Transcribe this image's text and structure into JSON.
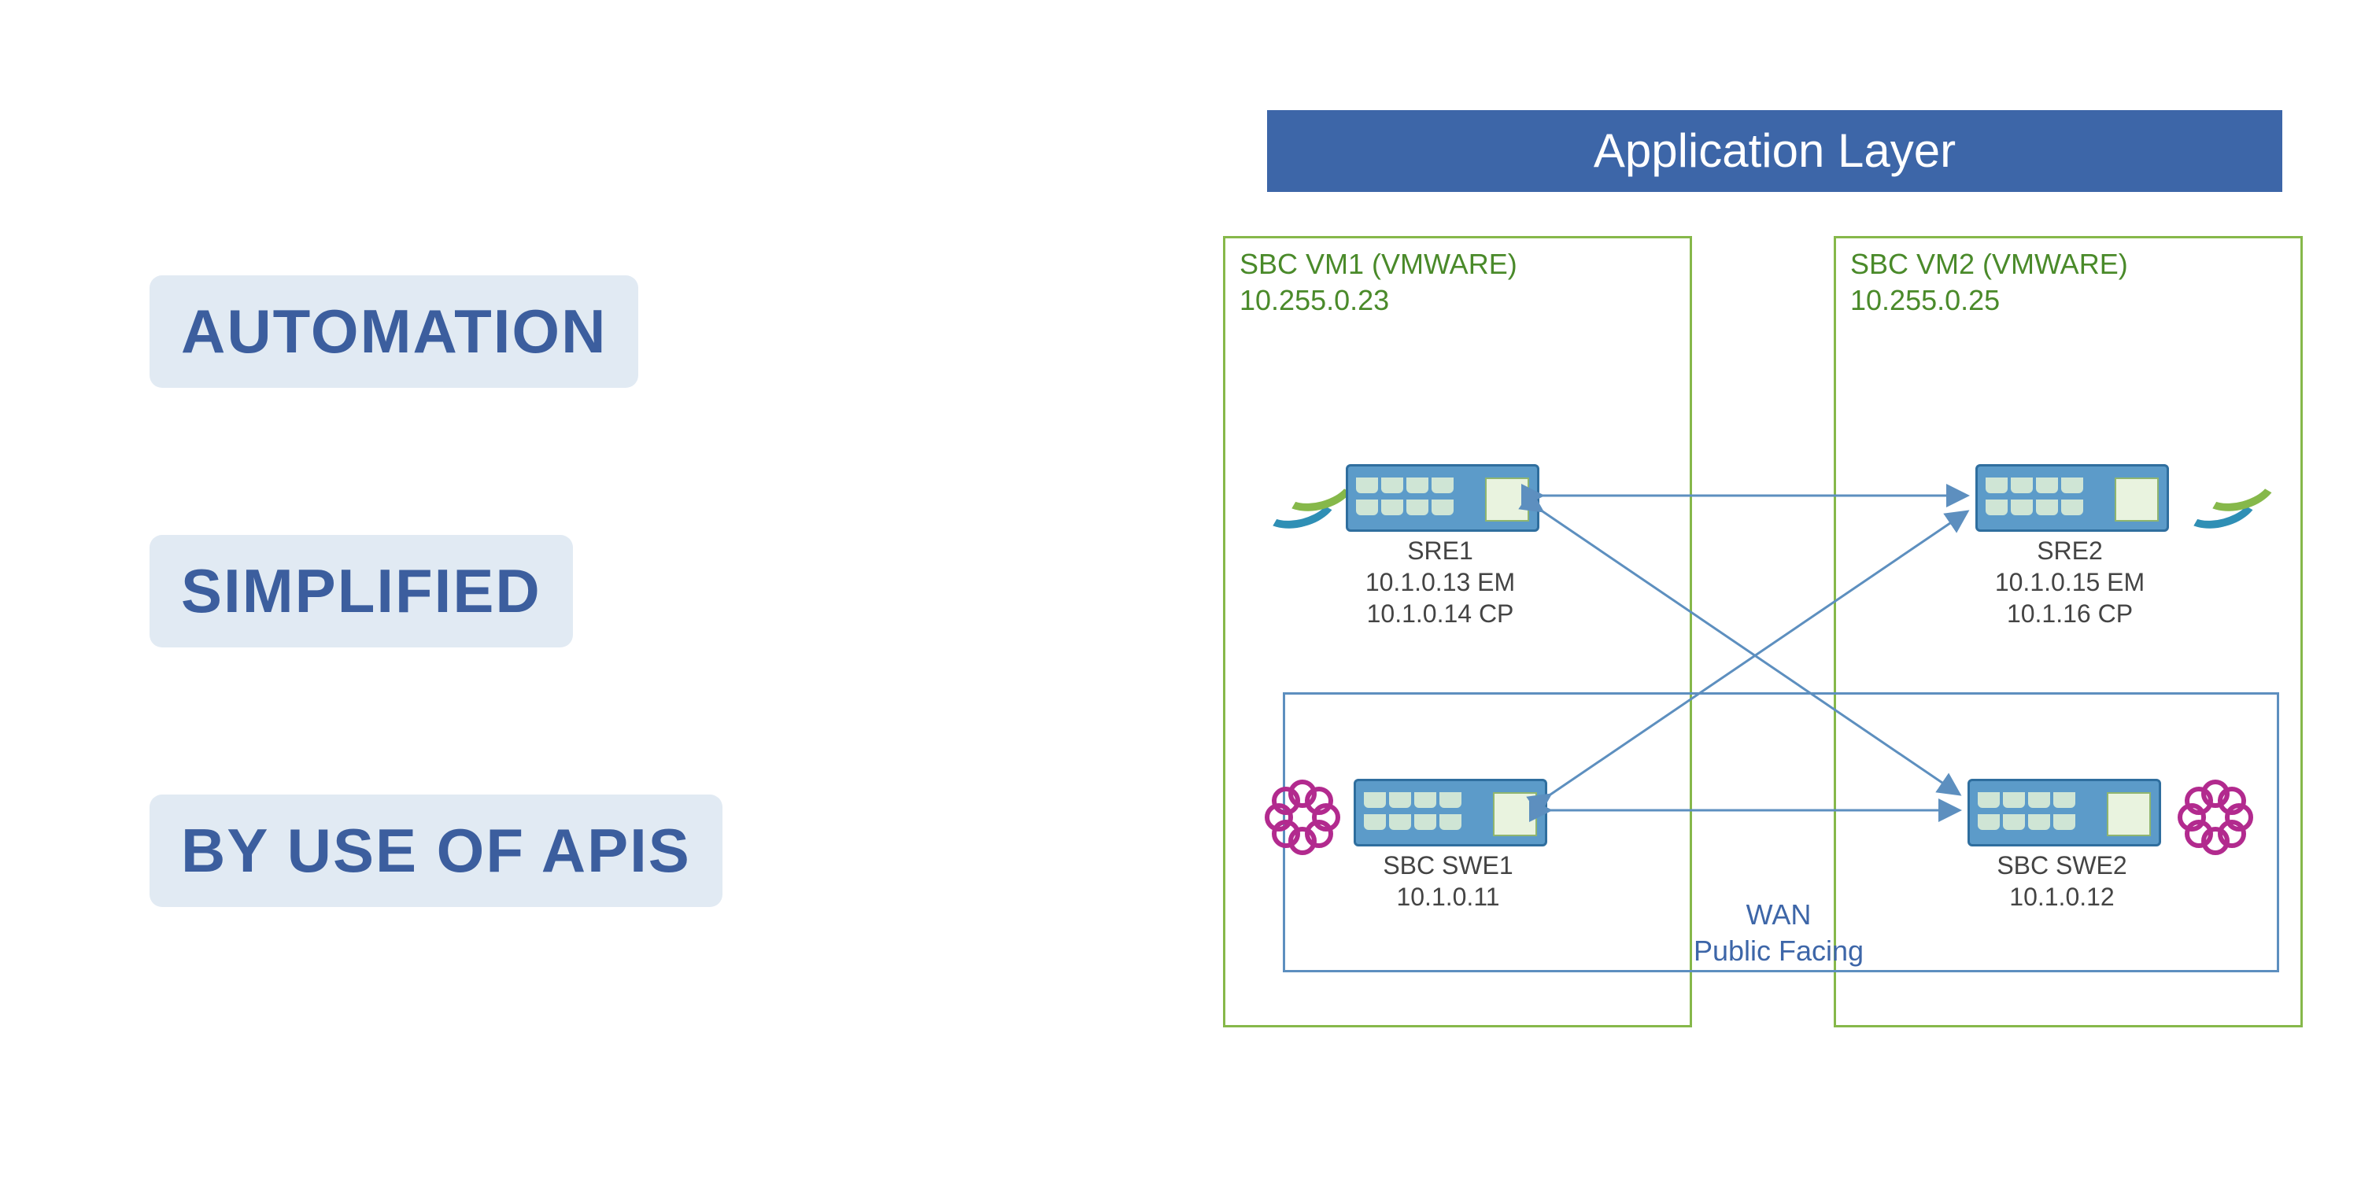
{
  "left_tags": [
    "AUTOMATION",
    "SIMPLIFIED",
    "BY USE OF APIS"
  ],
  "diagram": {
    "banner": "Application Layer",
    "vm1": {
      "title": "SBC VM1 (VMWARE)",
      "ip": "10.255.0.23"
    },
    "vm2": {
      "title": "SBC VM2 (VMWARE)",
      "ip": "10.255.0.25"
    },
    "sre1": {
      "name": "SRE1",
      "em": "10.1.0.13 EM",
      "cp": "10.1.0.14 CP"
    },
    "sre2": {
      "name": "SRE2",
      "em": "10.1.0.15 EM",
      "cp": "10.1.16 CP"
    },
    "swe1": {
      "name": "SBC SWE1",
      "ip": "10.1.0.11"
    },
    "swe2": {
      "name": "SBC SWE2",
      "ip": "10.1.0.12"
    },
    "wan": {
      "line1": "WAN",
      "line2": "Public Facing"
    }
  }
}
